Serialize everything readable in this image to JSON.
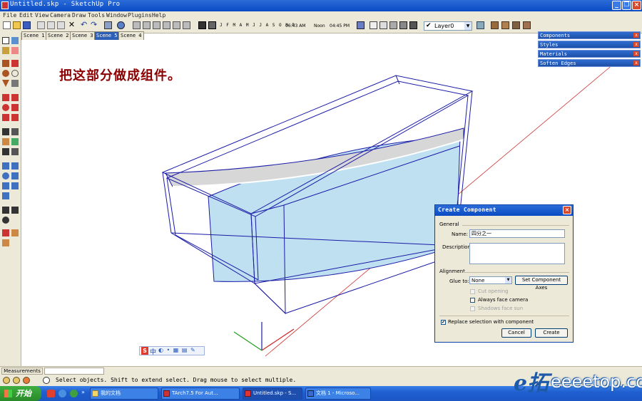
{
  "window": {
    "title": "Untitled.skp - SketchUp Pro",
    "min_label": "_",
    "max_label": "❐",
    "close_label": "×"
  },
  "menu": [
    "File",
    "Edit",
    "View",
    "Camera",
    "Draw",
    "Tools",
    "Window",
    "Plugins",
    "Help"
  ],
  "toolbar": {
    "months": "J F M A M J J A S O N D",
    "time_start": "06:43 AM",
    "noon": "Noon",
    "time_end": "04:45 PM",
    "layer": "Layer0"
  },
  "scenes": [
    {
      "label": "Scene 1",
      "active": false
    },
    {
      "label": "Scene 2",
      "active": false
    },
    {
      "label": "Scene 3",
      "active": false
    },
    {
      "label": "Scene 5",
      "active": true
    },
    {
      "label": "Scene 4",
      "active": false
    }
  ],
  "trays": [
    "Components",
    "Styles",
    "Materials",
    "Soften Edges"
  ],
  "caption": "把这部分做成组件。",
  "ime": {
    "s": "S",
    "zh": "中"
  },
  "dialog": {
    "title": "Create Component",
    "general_label": "General",
    "name_label": "Name:",
    "name_value": "四分之一",
    "description_label": "Description:",
    "description_value": "",
    "alignment_label": "Alignment",
    "glue_label": "Glue to:",
    "glue_value": "None",
    "set_axes_label": "Set Component Axes",
    "cut_opening_label": "Cut opening",
    "always_face_label": "Always face camera",
    "shadows_label": "Shadows face sun",
    "replace_label": "Replace selection with component",
    "replace_checked": "✔",
    "cancel_label": "Cancel",
    "create_label": "Create"
  },
  "measurements_label": "Measurements",
  "status_text": "Select objects. Shift to extend select. Drag mouse to select multiple.",
  "taskbar": {
    "start_label": "开始",
    "tasks": [
      {
        "label": "我的文档",
        "active": false
      },
      {
        "label": "TArch7.5 For Aut...",
        "active": false
      },
      {
        "label": "Untitled.skp - S...",
        "active": true
      },
      {
        "label": "文档 1 - Microso...",
        "active": false
      }
    ]
  },
  "watermark": {
    "logo": "e拓",
    "text": "eeeetop.com"
  },
  "colors": {
    "model_edges": "#1a1aa8",
    "model_fill": "#bfe0f0",
    "top_surface": "#d7d7d7",
    "caption": "#8b0000",
    "axis_red": "#cc2020",
    "axis_green": "#20a020",
    "axis_blue": "#1a1aa8"
  }
}
